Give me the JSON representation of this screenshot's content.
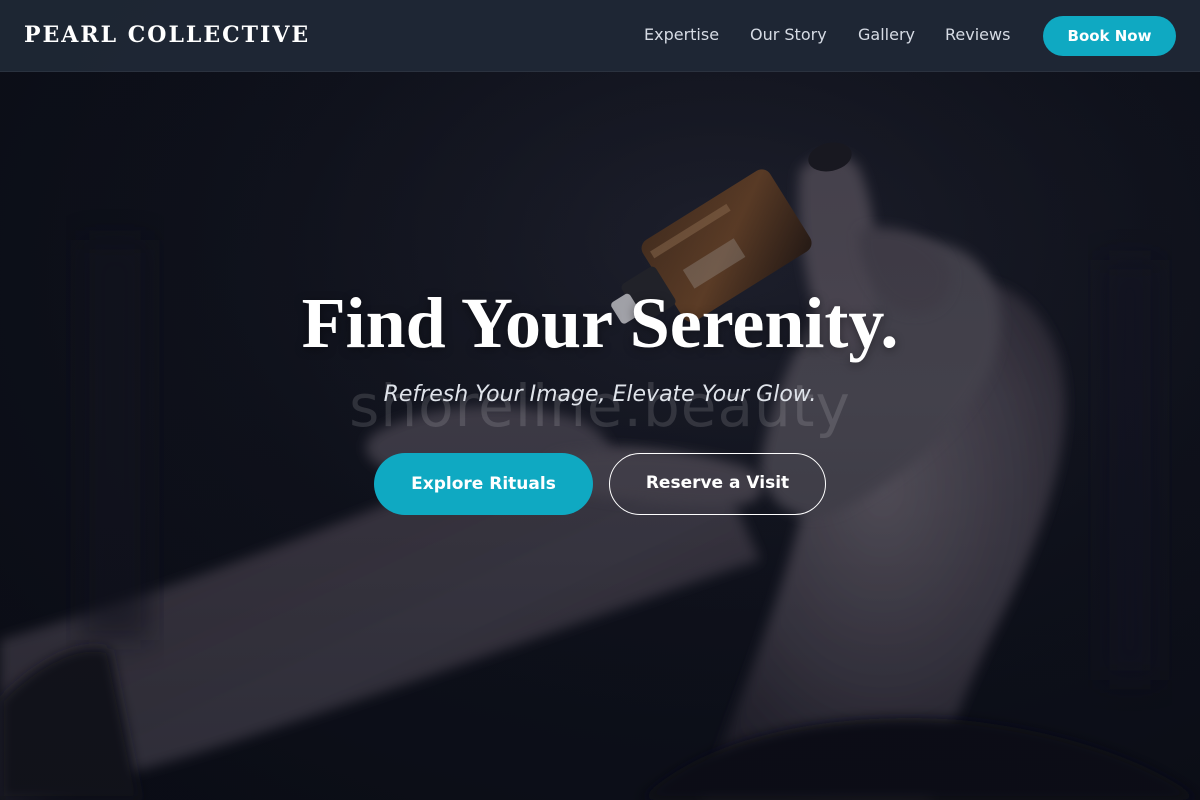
{
  "brand": {
    "name": "PEARL COLLECTIVE"
  },
  "nav": {
    "links": [
      {
        "label": "Expertise"
      },
      {
        "label": "Our Story"
      },
      {
        "label": "Gallery"
      },
      {
        "label": "Reviews"
      }
    ],
    "cta_label": "Book Now"
  },
  "hero": {
    "title": "Find Your Serenity.",
    "subtitle": "Refresh Your Image, Elevate Your Glow.",
    "watermark": "shoreline.beauty",
    "primary_cta": "Explore Rituals",
    "secondary_cta": "Reserve a Visit"
  },
  "colors": {
    "accent": "#0fa9c2",
    "navbar": "#202836",
    "background": "#0d1019"
  }
}
